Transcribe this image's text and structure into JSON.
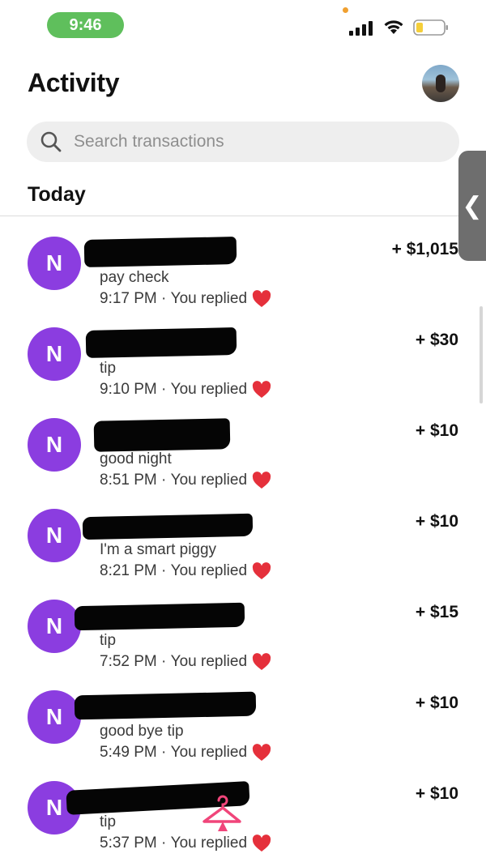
{
  "status_bar": {
    "time": "9:46"
  },
  "header": {
    "title": "Activity"
  },
  "search": {
    "placeholder": "Search transactions"
  },
  "section": {
    "heading": "Today"
  },
  "transactions": [
    {
      "initial": "N",
      "note": "pay check",
      "time": "9:17 PM",
      "reply": "You replied",
      "amount": "+ $1,015"
    },
    {
      "initial": "N",
      "note": "tip",
      "time": "9:10 PM",
      "reply": "You replied",
      "amount": "+ $30"
    },
    {
      "initial": "N",
      "note": "good night",
      "time": "8:51 PM",
      "reply": "You replied",
      "amount": "+ $10"
    },
    {
      "initial": "N",
      "note": "I'm a smart piggy",
      "time": "8:21 PM",
      "reply": "You replied",
      "amount": "+ $10"
    },
    {
      "initial": "N",
      "note": "tip",
      "time": "7:52 PM",
      "reply": "You replied",
      "amount": "+ $15"
    },
    {
      "initial": "N",
      "note": "good bye tip",
      "time": "5:49 PM",
      "reply": "You replied",
      "amount": "+ $10"
    },
    {
      "initial": "N",
      "note": "tip",
      "time": "5:37 PM",
      "reply": "You replied",
      "amount": "+ $10"
    }
  ],
  "colors": {
    "avatar": "#8b3de0",
    "heart": "#e5303b",
    "status_pill": "#5fbf5c",
    "hanger": "#f0457a"
  },
  "icons": {
    "search": "search-icon",
    "heart": "heart-icon",
    "signal": "signal-icon",
    "wifi": "wifi-icon",
    "battery": "battery-icon",
    "drawer": "chevron-left-icon",
    "sticker": "hanger-icon"
  }
}
